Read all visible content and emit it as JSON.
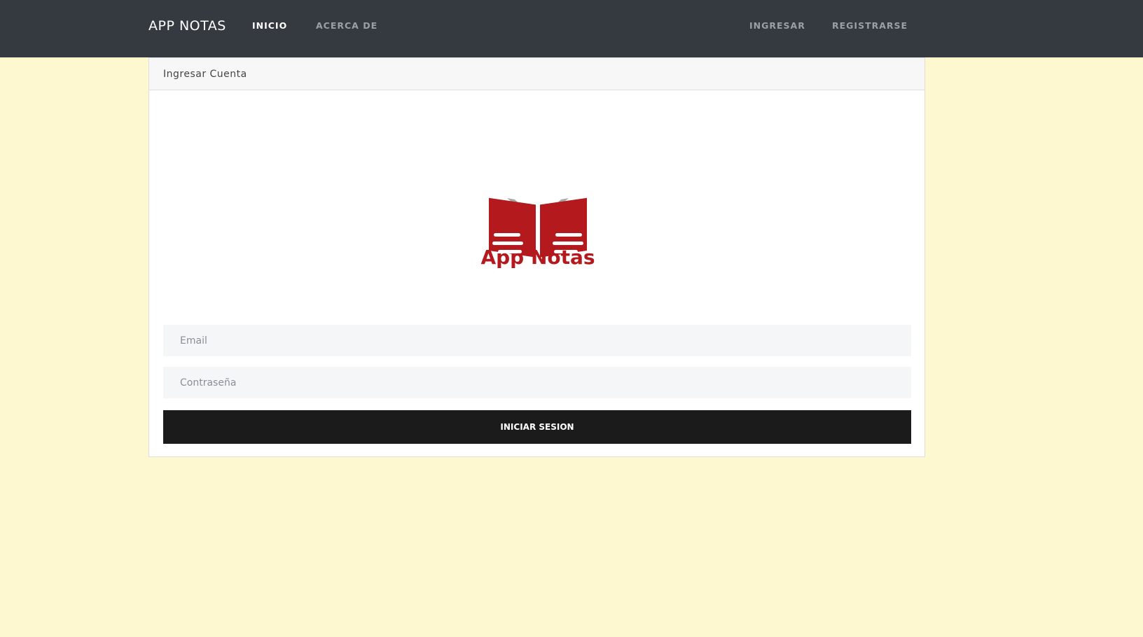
{
  "navbar": {
    "brand": "APP NOTAS",
    "links": [
      {
        "label": "INICIO",
        "active": true
      },
      {
        "label": "ACERCA DE",
        "active": false
      },
      {
        "label": "INGRESAR",
        "active": false
      },
      {
        "label": "REGISTRARSE",
        "active": false
      }
    ]
  },
  "login_card": {
    "header": "Ingresar Cuenta",
    "logo": {
      "icon": "book-hands-logo-icon",
      "text": "App Notas"
    },
    "email": {
      "value": "",
      "placeholder": "Email"
    },
    "password": {
      "value": "",
      "placeholder": "Contraseña"
    },
    "submit_label": "INICIAR SESION"
  },
  "colors": {
    "navbar": "#343a40",
    "page_background": "#fdf8cf",
    "logo_red": "#b3191d",
    "logo_gray": "#a7a7a7",
    "button": "#1b1b1c"
  }
}
